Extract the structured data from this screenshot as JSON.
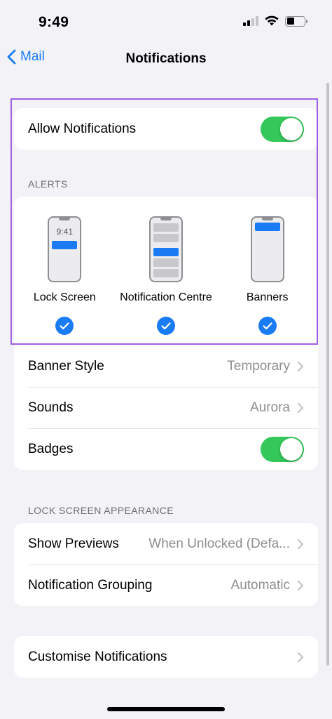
{
  "status": {
    "time": "9:49"
  },
  "nav": {
    "back_label": "Mail",
    "title": "Notifications"
  },
  "allow": {
    "label": "Allow Notifications",
    "on": true
  },
  "alerts": {
    "header": "ALERTS",
    "phone_time": "9:41",
    "options": [
      {
        "label": "Lock Screen",
        "checked": true
      },
      {
        "label": "Notification Centre",
        "checked": true
      },
      {
        "label": "Banners",
        "checked": true
      }
    ]
  },
  "alert_settings": {
    "banner_style": {
      "label": "Banner Style",
      "value": "Temporary"
    },
    "sounds": {
      "label": "Sounds",
      "value": "Aurora"
    },
    "badges": {
      "label": "Badges",
      "on": true
    }
  },
  "lock_screen": {
    "header": "LOCK SCREEN APPEARANCE",
    "show_previews": {
      "label": "Show Previews",
      "value": "When Unlocked (Defa..."
    },
    "grouping": {
      "label": "Notification Grouping",
      "value": "Automatic"
    }
  },
  "customise": {
    "label": "Customise Notifications"
  },
  "colors": {
    "accent": "#1a7cf5",
    "toggle_on": "#34c759",
    "highlight": "#a05ee2"
  },
  "icons": {
    "back": "chevron-left-icon",
    "disclosure": "chevron-right-icon",
    "check": "checkmark-icon"
  }
}
